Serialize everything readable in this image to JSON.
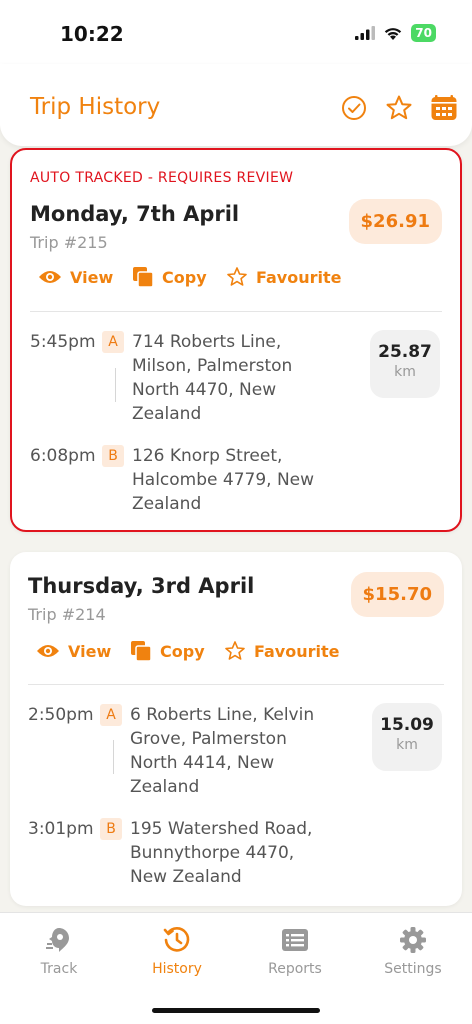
{
  "status": {
    "time": "10:22",
    "battery": "70"
  },
  "header": {
    "title": "Trip History"
  },
  "colors": {
    "accent": "#f0820f",
    "review": "#e0141e",
    "badge_bg": "#fdeadb"
  },
  "trips": [
    {
      "review_label": "AUTO TRACKED - REQUIRES REVIEW",
      "date": "Monday, 7th April",
      "number": "Trip #215",
      "price": "$26.91",
      "actions": {
        "view": "View",
        "copy": "Copy",
        "favourite": "Favourite"
      },
      "start": {
        "time": "5:45pm",
        "badge": "A",
        "address": "714 Roberts Line, Milson, Palmerston North 4470, New Zealand"
      },
      "end": {
        "time": "6:08pm",
        "badge": "B",
        "address": "126 Knorp Street, Halcombe 4779, New Zealand"
      },
      "distance": "25.87",
      "unit": "km"
    },
    {
      "date": "Thursday, 3rd April",
      "number": "Trip #214",
      "price": "$15.70",
      "actions": {
        "view": "View",
        "copy": "Copy",
        "favourite": "Favourite"
      },
      "start": {
        "time": "2:50pm",
        "badge": "A",
        "address": "6 Roberts Line, Kelvin Grove, Palmerston North 4414, New Zealand"
      },
      "end": {
        "time": "3:01pm",
        "badge": "B",
        "address": "195 Watershed Road, Bunnythorpe 4470, New Zealand"
      },
      "distance": "15.09",
      "unit": "km"
    }
  ],
  "tabs": [
    {
      "label": "Track",
      "icon": "track-icon"
    },
    {
      "label": "History",
      "icon": "history-icon"
    },
    {
      "label": "Reports",
      "icon": "reports-icon"
    },
    {
      "label": "Settings",
      "icon": "gear-icon"
    }
  ]
}
